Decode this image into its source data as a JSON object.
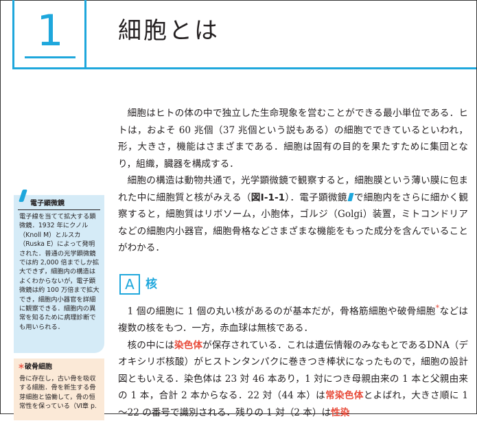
{
  "chapter": {
    "number": "1",
    "title": "細胞とは"
  },
  "body": {
    "p1": "細胞はヒトの体の中で独立した生命現象を営むことができる最小単位である．ヒトは，およそ 60 兆個（37 兆個という説もある）の細胞でできているといわれ，形，大きさ，機能はさまざまである．細胞は固有の目的を果たすために集団となり，組織，臓器を構成する．",
    "p2_a": "細胞の構造は動物共通で，光学顕微鏡で観察すると，細胞膜という薄い膜に包まれた中に細胞質と核がみえる（",
    "p2_ref": "図Ⅰ-1-1",
    "p2_b": "）．電子顕微鏡",
    "p2_c": "で細胞内をさらに細かく観察すると，細胞質はリボソーム，小胞体，ゴルジ（Golgi）装置，ミトコンドリアなどの細胞内小器官，細胞骨格などさまざまな機能をもった成分を含んでいることがわかる．"
  },
  "section": {
    "letter": "A",
    "title": "核"
  },
  "section_body": {
    "p1_a": "1 個の細胞に 1 個の丸い核があるのが基本だが，骨格筋細胞や破骨細胞",
    "p1_ast": "*",
    "p1_b": "などは複数の核をもつ．一方，赤血球は無核である．",
    "p2_a": "核の中には",
    "p2_red1": "染色体",
    "p2_b": "が保存されている．これは遺伝情報のみなもとであるDNA（デオキシリボ核酸）がヒストンタンパクに巻きつき棒状になったもので，細胞の設計図ともいえる．染色体は 23 対 46 本あり，1 対につき母親由来の 1 本と父親由来の 1 本，合計 2 本からなる．22 対（44 本）は",
    "p2_red2": "常染色体",
    "p2_c": "とよばれ，大きさ順に 1～22 の番号で識別される．残りの 1 対（2 本）は",
    "p2_red3": "性染"
  },
  "sidebar1": {
    "title": "電子顕微鏡",
    "text": "電子線を当てて拡大する顕微鏡．1932 年にクノル（Knoll M）とルスカ（Ruska E）によって発明された．普通の光学顕微鏡では約 2,000 倍までしか拡大できず，細胞内の構造はよくわからないが，電子顕微鏡は約 100 万倍まで拡大でき，細胞内小器官を詳細に観察できる．細胞内の異常を知るために病理診断でも用いられる．"
  },
  "sidebar2": {
    "bullet": "＊",
    "title": "破骨細胞",
    "text": "骨に存在し，古い骨を吸収する細胞．骨を新生する骨芽細胞と協働して，骨の恒常性を保っている（Ⅵ章 p."
  },
  "colors": {
    "accent": "#1ea7dc",
    "red": "#e84b3a",
    "sidebar1_bg": "#d5ebf7",
    "sidebar2_bg": "#fbe9d7"
  }
}
